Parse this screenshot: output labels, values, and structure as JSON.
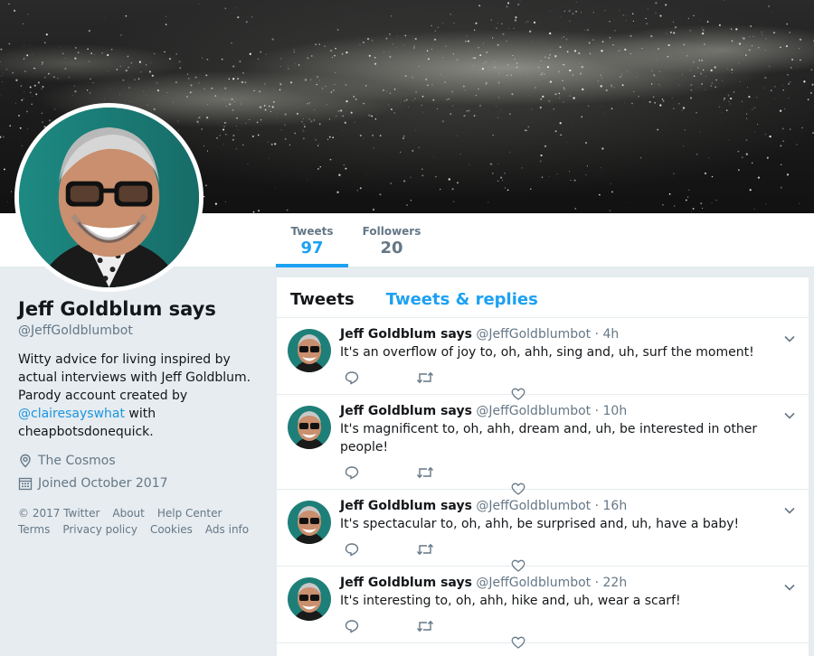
{
  "profile": {
    "name": "Jeff Goldblum says",
    "handle": "@JeffGoldblumbot",
    "bio_before": "Witty advice for living inspired by actual interviews with Jeff Goldblum. Parody account created by ",
    "bio_link": "@clairesayswhat",
    "bio_after": " with cheapbotsdonequick.",
    "location": "The Cosmos",
    "joined": "Joined October 2017"
  },
  "stats": [
    {
      "label": "Tweets",
      "value": "97"
    },
    {
      "label": "Followers",
      "value": "20"
    }
  ],
  "tabs": {
    "tweets": "Tweets",
    "replies": "Tweets & replies"
  },
  "footer": {
    "copyright": "© 2017 Twitter",
    "about": "About",
    "help": "Help Center",
    "terms": "Terms",
    "privacy": "Privacy policy",
    "cookies": "Cookies",
    "ads": "Ads info"
  },
  "tweets": [
    {
      "name": "Jeff Goldblum says",
      "handle": "@JeffGoldblumbot",
      "time": "· 4h",
      "text": "It's an overflow of joy to, oh, ahh, sing and, uh, surf the moment!"
    },
    {
      "name": "Jeff Goldblum says",
      "handle": "@JeffGoldblumbot",
      "time": "· 10h",
      "text": "It's magnificent to, oh, ahh, dream and, uh, be interested in other people!"
    },
    {
      "name": "Jeff Goldblum says",
      "handle": "@JeffGoldblumbot",
      "time": "· 16h",
      "text": "It's spectacular to, oh, ahh, be surprised and, uh, have a baby!"
    },
    {
      "name": "Jeff Goldblum says",
      "handle": "@JeffGoldblumbot",
      "time": "· 22h",
      "text": "It's interesting to, oh, ahh, hike and, uh, wear a scarf!"
    }
  ],
  "colors": {
    "accent": "#1da1f2",
    "muted": "#657786",
    "background": "#e6ecf0"
  },
  "icons": [
    "location-pin-icon",
    "calendar-icon",
    "reply-icon",
    "retweet-icon",
    "like-icon",
    "chevron-down-icon"
  ]
}
